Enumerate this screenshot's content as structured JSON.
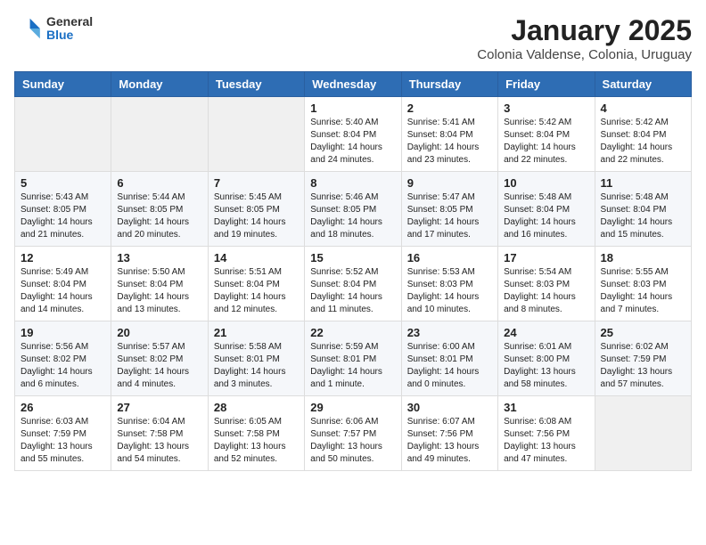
{
  "logo": {
    "general": "General",
    "blue": "Blue"
  },
  "title": "January 2025",
  "subtitle": "Colonia Valdense, Colonia, Uruguay",
  "weekdays": [
    "Sunday",
    "Monday",
    "Tuesday",
    "Wednesday",
    "Thursday",
    "Friday",
    "Saturday"
  ],
  "weeks": [
    [
      null,
      null,
      null,
      {
        "day": "1",
        "sunrise": "5:40 AM",
        "sunset": "8:04 PM",
        "daylight": "14 hours and 24 minutes."
      },
      {
        "day": "2",
        "sunrise": "5:41 AM",
        "sunset": "8:04 PM",
        "daylight": "14 hours and 23 minutes."
      },
      {
        "day": "3",
        "sunrise": "5:42 AM",
        "sunset": "8:04 PM",
        "daylight": "14 hours and 22 minutes."
      },
      {
        "day": "4",
        "sunrise": "5:42 AM",
        "sunset": "8:04 PM",
        "daylight": "14 hours and 22 minutes."
      }
    ],
    [
      {
        "day": "5",
        "sunrise": "5:43 AM",
        "sunset": "8:05 PM",
        "daylight": "14 hours and 21 minutes."
      },
      {
        "day": "6",
        "sunrise": "5:44 AM",
        "sunset": "8:05 PM",
        "daylight": "14 hours and 20 minutes."
      },
      {
        "day": "7",
        "sunrise": "5:45 AM",
        "sunset": "8:05 PM",
        "daylight": "14 hours and 19 minutes."
      },
      {
        "day": "8",
        "sunrise": "5:46 AM",
        "sunset": "8:05 PM",
        "daylight": "14 hours and 18 minutes."
      },
      {
        "day": "9",
        "sunrise": "5:47 AM",
        "sunset": "8:05 PM",
        "daylight": "14 hours and 17 minutes."
      },
      {
        "day": "10",
        "sunrise": "5:48 AM",
        "sunset": "8:04 PM",
        "daylight": "14 hours and 16 minutes."
      },
      {
        "day": "11",
        "sunrise": "5:48 AM",
        "sunset": "8:04 PM",
        "daylight": "14 hours and 15 minutes."
      }
    ],
    [
      {
        "day": "12",
        "sunrise": "5:49 AM",
        "sunset": "8:04 PM",
        "daylight": "14 hours and 14 minutes."
      },
      {
        "day": "13",
        "sunrise": "5:50 AM",
        "sunset": "8:04 PM",
        "daylight": "14 hours and 13 minutes."
      },
      {
        "day": "14",
        "sunrise": "5:51 AM",
        "sunset": "8:04 PM",
        "daylight": "14 hours and 12 minutes."
      },
      {
        "day": "15",
        "sunrise": "5:52 AM",
        "sunset": "8:04 PM",
        "daylight": "14 hours and 11 minutes."
      },
      {
        "day": "16",
        "sunrise": "5:53 AM",
        "sunset": "8:03 PM",
        "daylight": "14 hours and 10 minutes."
      },
      {
        "day": "17",
        "sunrise": "5:54 AM",
        "sunset": "8:03 PM",
        "daylight": "14 hours and 8 minutes."
      },
      {
        "day": "18",
        "sunrise": "5:55 AM",
        "sunset": "8:03 PM",
        "daylight": "14 hours and 7 minutes."
      }
    ],
    [
      {
        "day": "19",
        "sunrise": "5:56 AM",
        "sunset": "8:02 PM",
        "daylight": "14 hours and 6 minutes."
      },
      {
        "day": "20",
        "sunrise": "5:57 AM",
        "sunset": "8:02 PM",
        "daylight": "14 hours and 4 minutes."
      },
      {
        "day": "21",
        "sunrise": "5:58 AM",
        "sunset": "8:01 PM",
        "daylight": "14 hours and 3 minutes."
      },
      {
        "day": "22",
        "sunrise": "5:59 AM",
        "sunset": "8:01 PM",
        "daylight": "14 hours and 1 minute."
      },
      {
        "day": "23",
        "sunrise": "6:00 AM",
        "sunset": "8:01 PM",
        "daylight": "14 hours and 0 minutes."
      },
      {
        "day": "24",
        "sunrise": "6:01 AM",
        "sunset": "8:00 PM",
        "daylight": "13 hours and 58 minutes."
      },
      {
        "day": "25",
        "sunrise": "6:02 AM",
        "sunset": "7:59 PM",
        "daylight": "13 hours and 57 minutes."
      }
    ],
    [
      {
        "day": "26",
        "sunrise": "6:03 AM",
        "sunset": "7:59 PM",
        "daylight": "13 hours and 55 minutes."
      },
      {
        "day": "27",
        "sunrise": "6:04 AM",
        "sunset": "7:58 PM",
        "daylight": "13 hours and 54 minutes."
      },
      {
        "day": "28",
        "sunrise": "6:05 AM",
        "sunset": "7:58 PM",
        "daylight": "13 hours and 52 minutes."
      },
      {
        "day": "29",
        "sunrise": "6:06 AM",
        "sunset": "7:57 PM",
        "daylight": "13 hours and 50 minutes."
      },
      {
        "day": "30",
        "sunrise": "6:07 AM",
        "sunset": "7:56 PM",
        "daylight": "13 hours and 49 minutes."
      },
      {
        "day": "31",
        "sunrise": "6:08 AM",
        "sunset": "7:56 PM",
        "daylight": "13 hours and 47 minutes."
      },
      null
    ]
  ]
}
